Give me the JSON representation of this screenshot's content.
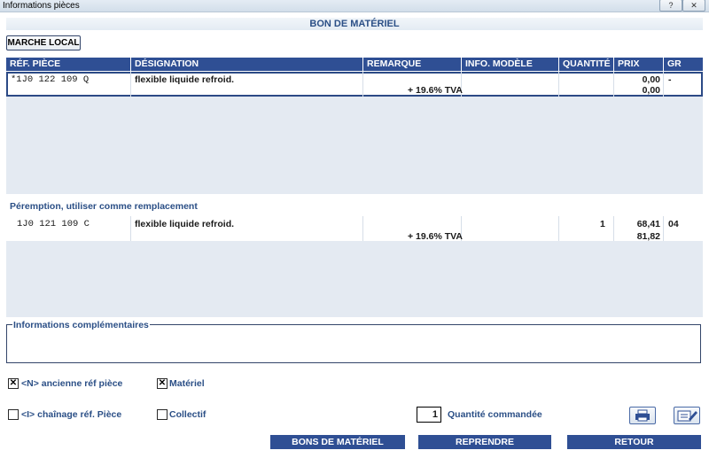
{
  "window": {
    "title": "Informations pièces",
    "help_glyph": "?",
    "close_glyph": "✕"
  },
  "header": {
    "title": "BON DE MATÉRIEL"
  },
  "market_button": "MARCHE LOCAL",
  "columns": [
    "RÉF. PIÈCE",
    "DÉSIGNATION",
    "REMARQUE",
    "INFO. MODÈLE",
    "QUANTITÉ",
    "PRIX",
    "GR"
  ],
  "main_row": {
    "ref": "*1J0 122 109 Q",
    "designation": "flexible liquide refroid.",
    "remark": "+ 19.6% TVA",
    "info": "",
    "quantity": "",
    "price": "0,00",
    "price_ttc": "0,00",
    "gr": "-"
  },
  "replacement": {
    "title": "Péremption, utiliser comme remplacement",
    "row": {
      "ref": "1J0 121 109 C",
      "designation": "flexible liquide refroid.",
      "remark": "+ 19.6% TVA",
      "info": "",
      "quantity": "1",
      "price": "68,41",
      "price_ttc": "81,82",
      "gr": "04"
    }
  },
  "info_section": {
    "title": "Informations complémentaires"
  },
  "checkboxes": {
    "old_ref": {
      "label": "<N> ancienne réf pièce",
      "checked": true,
      "mark": "✕"
    },
    "material": {
      "label": "Matériel",
      "checked": true,
      "mark": "✕"
    },
    "chain": {
      "label": "<I> chaînage réf. Pièce",
      "checked": false,
      "mark": ""
    },
    "collective": {
      "label": "Collectif",
      "checked": false,
      "mark": ""
    }
  },
  "quantity": {
    "value": "1",
    "label": "Quantité commandée"
  },
  "icons": {
    "print": "printer-icon",
    "edit": "edit-icon"
  },
  "buttons": {
    "bons": "BONS DE MATÉRIEL",
    "reprendre": "REPRENDRE",
    "retour": "RETOUR"
  },
  "colors": {
    "header_blue": "#2f4f94",
    "label_blue": "#2b4f86",
    "grid_bg": "#e4eaf2"
  }
}
